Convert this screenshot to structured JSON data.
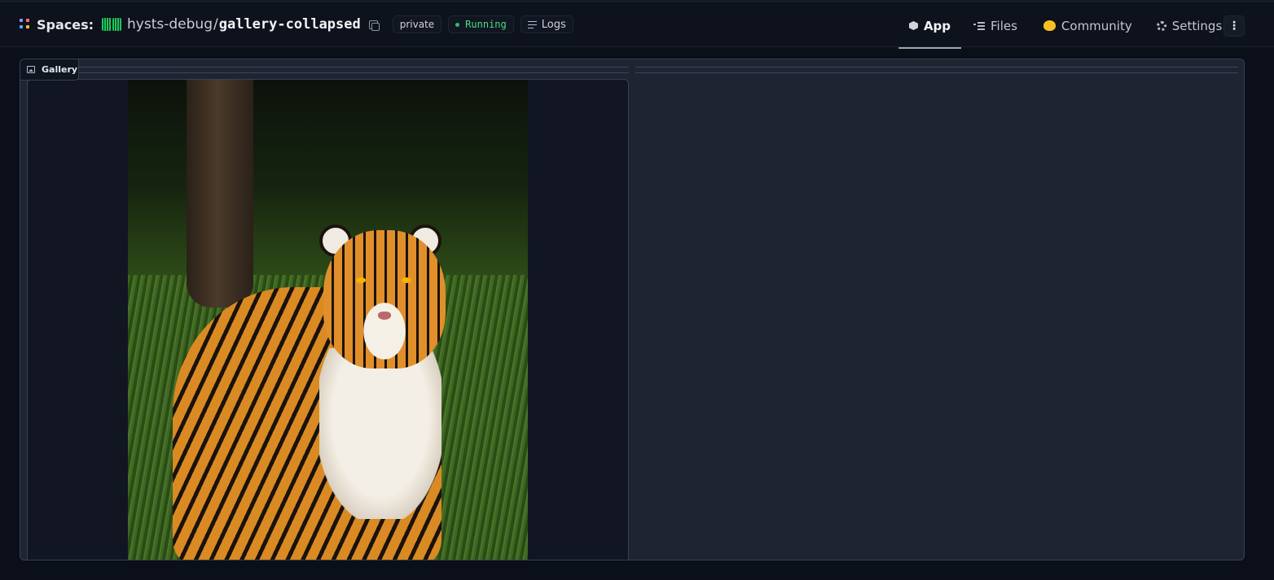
{
  "header": {
    "spaces_label": "Spaces:",
    "owner": "hysts-debug",
    "separator": "/",
    "repo": "gallery-collapsed",
    "visibility": "private",
    "status": "Running",
    "logs_label": "Logs",
    "status_color": "#22c55e",
    "nav": [
      {
        "label": "App",
        "icon": "cube-icon",
        "active": true
      },
      {
        "label": "Files",
        "icon": "files-icon",
        "active": false
      },
      {
        "label": "Community",
        "icon": "hugging-face-icon",
        "active": false
      },
      {
        "label": "Settings",
        "icon": "gear-icon",
        "active": false
      }
    ],
    "menu_glyph": "⋮"
  },
  "main": {
    "gallery_label": "Gallery",
    "gallery_icon": "image-icon"
  }
}
